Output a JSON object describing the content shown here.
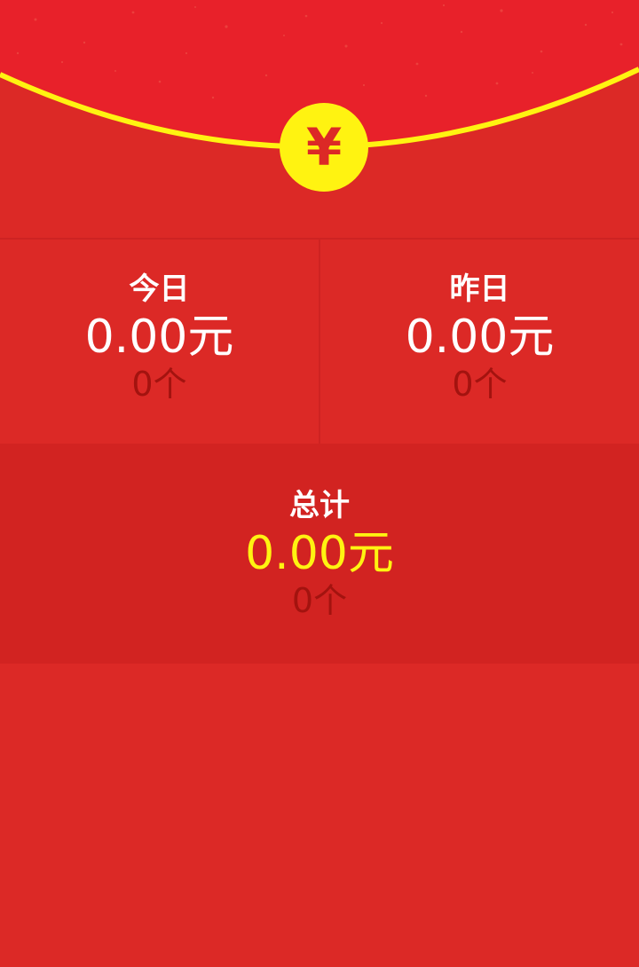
{
  "header": {
    "coin_symbol": "¥",
    "colors": {
      "envelope": "#E8212A",
      "accent": "#FFF311",
      "background": "#DC2926"
    }
  },
  "today": {
    "label": "今日",
    "amount": "0.00元",
    "count": "0个"
  },
  "yesterday": {
    "label": "昨日",
    "amount": "0.00元",
    "count": "0个"
  },
  "total": {
    "label": "总计",
    "amount": "0.00元",
    "count": "0个"
  }
}
